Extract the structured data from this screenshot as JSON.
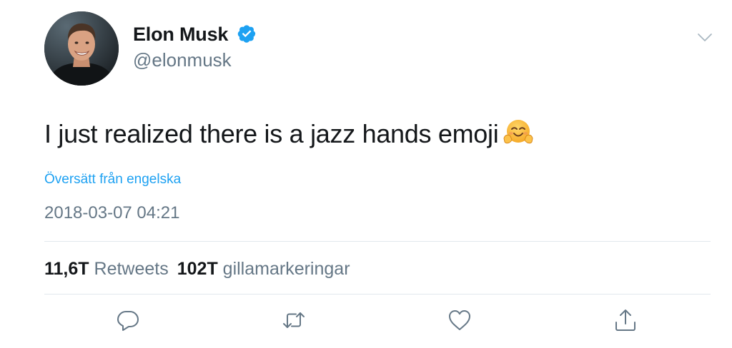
{
  "author": {
    "display_name": "Elon Musk",
    "handle": "@elonmusk",
    "verified": true
  },
  "tweet": {
    "text": "I just realized there is a jazz hands emoji",
    "emoji": "hugging-face",
    "translate_label": "Översätt från engelska",
    "timestamp": "2018-03-07 04:21"
  },
  "stats": {
    "retweets_count": "11,6T",
    "retweets_label": "Retweets",
    "likes_count": "102T",
    "likes_label": "gillamarkeringar"
  },
  "actions": {
    "icons": [
      "reply-icon",
      "retweet-icon",
      "like-icon",
      "share-icon"
    ]
  },
  "colors": {
    "primary_text": "#14171a",
    "secondary_text": "#657786",
    "link": "#1da1f2",
    "divider": "#e1e8ed",
    "verified": "#1da1f2"
  }
}
